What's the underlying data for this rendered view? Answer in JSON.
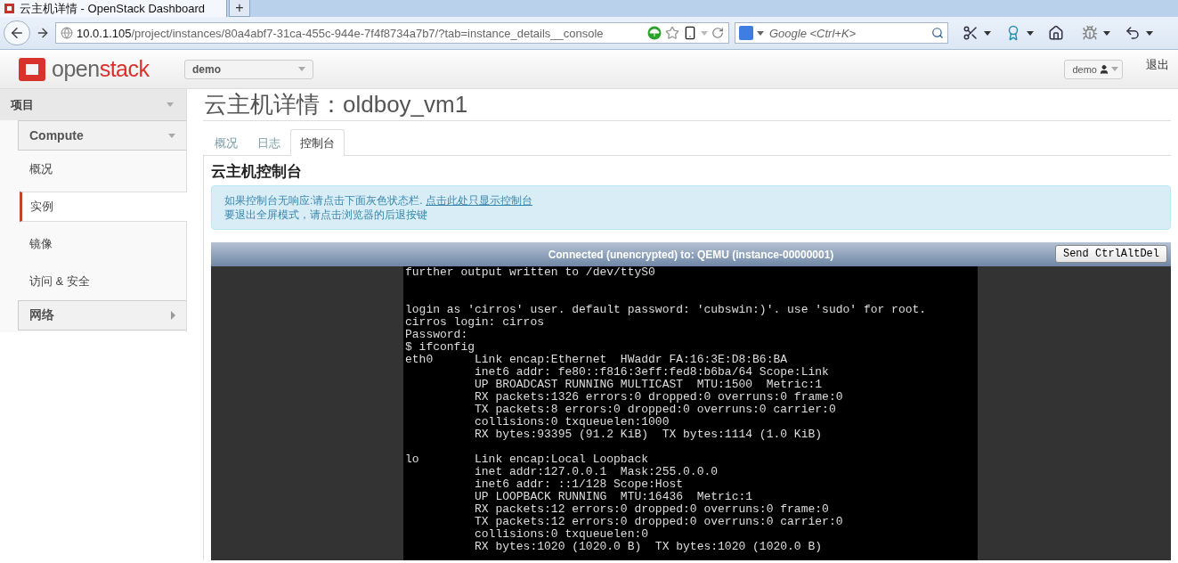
{
  "browser": {
    "tab_title": "云主机详情 - OpenStack Dashboard",
    "new_tab": "+",
    "url": {
      "host": "10.0.1.105",
      "path": "/project/instances/80a4abf7-31ca-455c-944e-7f4f8734a7b7/?tab=instance_details__console"
    },
    "search": {
      "placeholder": "Google <Ctrl+K>"
    }
  },
  "header": {
    "logo": {
      "part1": "open",
      "part2": "stack"
    },
    "project_select": "demo",
    "user_menu": "demo",
    "logout": "退出"
  },
  "sidebar": {
    "dashboard": {
      "label": "项目",
      "expanded": true
    },
    "panels": [
      {
        "label": "Compute",
        "expanded": true,
        "items": [
          {
            "label": "概况",
            "selected": false
          },
          {
            "label": "实例",
            "selected": true
          },
          {
            "label": "镜像",
            "selected": false
          },
          {
            "label": "访问 & 安全",
            "selected": false
          }
        ]
      },
      {
        "label": "网络",
        "expanded": false
      }
    ]
  },
  "page": {
    "title": "云主机详情：oldboy_vm1",
    "tabs": [
      {
        "label": "概况",
        "selected": false
      },
      {
        "label": "日志",
        "selected": false
      },
      {
        "label": "控制台",
        "selected": true
      }
    ],
    "console": {
      "heading": "云主机控制台",
      "info": {
        "text": "如果控制台无响应:请点击下面灰色状态栏.",
        "link": "点击此处只显示控制台",
        "line2": "要退出全屏模式，请点击浏览器的后退按键"
      },
      "status": "Connected (unencrypted) to: QEMU (instance-00000001)",
      "send_button": "Send CtrlAltDel",
      "lines": [
        {
          "kind": "text",
          "text": "further output written to /dev/ttyS0"
        },
        {
          "kind": "blank"
        },
        {
          "kind": "blank"
        },
        {
          "kind": "text",
          "text": "login as 'cirros' user. default password: 'cubswin:)'. use 'sudo' for root."
        },
        {
          "kind": "text",
          "text": "cirros login: cirros"
        },
        {
          "kind": "text",
          "text": "Password:"
        },
        {
          "kind": "text",
          "text": "$ ifconfig"
        },
        {
          "kind": "text",
          "text": "eth0      Link encap:Ethernet  HWaddr FA:16:3E:D8:B6:BA"
        },
        {
          "kind": "text",
          "text": "          inet6 addr: fe80::f816:3eff:fed8:b6ba/64 Scope:Link"
        },
        {
          "kind": "text",
          "text": "          UP BROADCAST RUNNING MULTICAST  MTU:1500  Metric:1"
        },
        {
          "kind": "text",
          "text": "          RX packets:1326 errors:0 dropped:0 overruns:0 frame:0"
        },
        {
          "kind": "text",
          "text": "          TX packets:8 errors:0 dropped:0 overruns:0 carrier:0"
        },
        {
          "kind": "text",
          "text": "          collisions:0 txqueuelen:1000"
        },
        {
          "kind": "text",
          "text": "          RX bytes:93395 (91.2 KiB)  TX bytes:1114 (1.0 KiB)"
        },
        {
          "kind": "blank"
        },
        {
          "kind": "text",
          "text": "lo        Link encap:Local Loopback"
        },
        {
          "kind": "text",
          "text": "          inet addr:127.0.0.1  Mask:255.0.0.0"
        },
        {
          "kind": "text",
          "text": "          inet6 addr: ::1/128 Scope:Host"
        },
        {
          "kind": "text",
          "text": "          UP LOOPBACK RUNNING  MTU:16436  Metric:1"
        },
        {
          "kind": "text",
          "text": "          RX packets:12 errors:0 dropped:0 overruns:0 frame:0"
        },
        {
          "kind": "text",
          "text": "          TX packets:12 errors:0 dropped:0 overruns:0 carrier:0"
        },
        {
          "kind": "text",
          "text": "          collisions:0 txqueuelen:0"
        },
        {
          "kind": "text",
          "text": "          RX bytes:1020 (1020.0 B)  TX bytes:1020 (1020.0 B)"
        }
      ]
    }
  }
}
